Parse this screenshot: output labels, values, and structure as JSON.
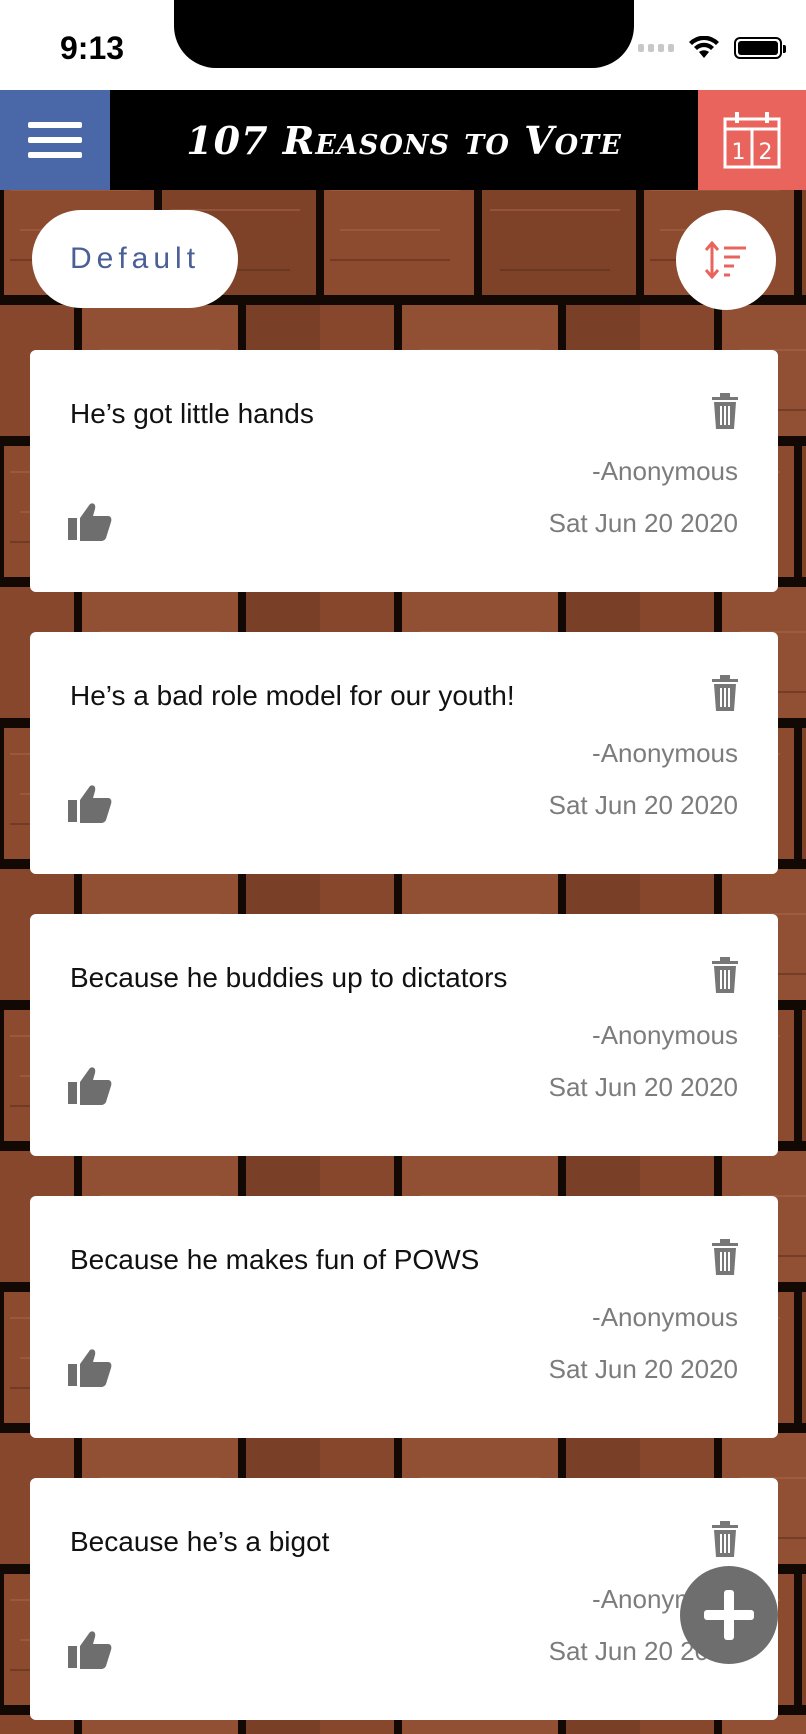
{
  "status_bar": {
    "time": "9:13"
  },
  "header": {
    "title": "107 Reasons to Vote",
    "menu_icon": "hamburger-menu-icon",
    "calendar_icon": "calendar-icon",
    "calendar_digits": [
      "1",
      "2"
    ]
  },
  "controls": {
    "filter_label": "Default",
    "sort_icon": "sort-icon"
  },
  "reasons": [
    {
      "text": "He’s got little hands",
      "author": "-Anonymous",
      "date": "Sat Jun 20 2020"
    },
    {
      "text": "He’s a bad role model for our youth!",
      "author": "-Anonymous",
      "date": "Sat Jun 20 2020"
    },
    {
      "text": "Because he buddies up to dictators",
      "author": "-Anonymous",
      "date": "Sat Jun 20 2020"
    },
    {
      "text": "Because he makes fun of POWS",
      "author": "-Anonymous",
      "date": "Sat Jun 20 2020"
    },
    {
      "text": "Because he’s a bigot",
      "author": "-Anonymous",
      "date": "Sat Jun 20 2020"
    }
  ],
  "colors": {
    "menu_bg": "#4a67a8",
    "calendar_bg": "#e8645c",
    "header_bg": "#000000",
    "filter_text": "#4a5f97",
    "brick": "#8a4a2e",
    "muted_text": "#7c7c7c",
    "fab_bg": "#6e6e6e"
  },
  "fab": {
    "icon": "plus-icon"
  }
}
